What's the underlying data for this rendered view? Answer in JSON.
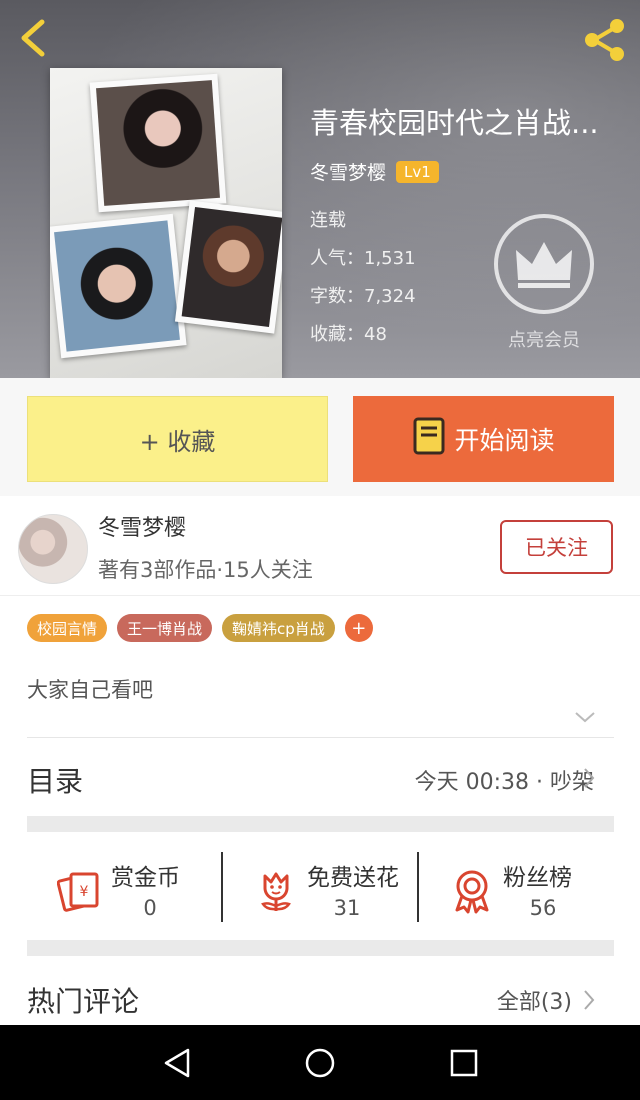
{
  "book": {
    "title": "青春校园时代之肖战...",
    "author": "冬雪梦樱",
    "level": "Lv1",
    "status": "连载",
    "popularity": "人气：1,531",
    "word_count": "字数：7,324",
    "favorites": "收藏：48"
  },
  "vip": {
    "label": "点亮会员"
  },
  "actions": {
    "collect_label": "+ 收藏",
    "read_label": "开始阅读"
  },
  "author_card": {
    "name": "冬雪梦樱",
    "info": "著有3部作品·15人关注",
    "follow_label": "已关注"
  },
  "tags": [
    {
      "label": "校园言情",
      "color": "#f0a23a"
    },
    {
      "label": "王一博肖战",
      "color": "#c8695c"
    },
    {
      "label": "鞠婧祎cp肖战",
      "color": "#c9a03f"
    }
  ],
  "tag_add": "+",
  "intro": "大家自己看吧",
  "catalog": {
    "title": "目录",
    "latest": "今天 00:38 · 吵架"
  },
  "stats": [
    {
      "label": "赏金币",
      "value": "0",
      "icon": "red-envelope-icon"
    },
    {
      "label": "免费送花",
      "value": "31",
      "icon": "flower-icon"
    },
    {
      "label": "粉丝榜",
      "value": "56",
      "icon": "medal-icon"
    }
  ],
  "hot_comments": {
    "title": "热门评论",
    "all_label": "全部(3)"
  },
  "colors": {
    "accent": "#ec6a3c",
    "collect": "#fbf08a",
    "follow": "#c4403b",
    "level": "#f5b52c"
  }
}
